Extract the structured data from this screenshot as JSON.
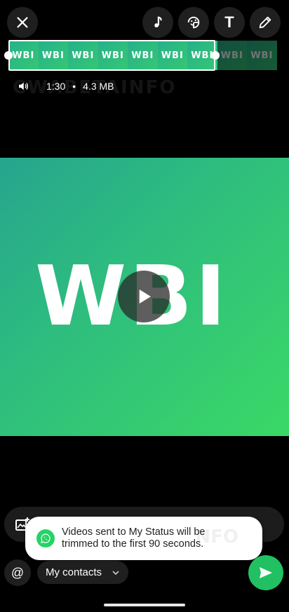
{
  "top_bar": {
    "close_icon": "close-icon",
    "tools": [
      "music-note-icon",
      "sticker-icon",
      "text-icon",
      "pencil-icon"
    ],
    "text_tool_label": "T"
  },
  "trim": {
    "frame_label": "WBI",
    "frames_selected": 7,
    "frames_dim": 2
  },
  "meta": {
    "duration": "1:30",
    "separator": "•",
    "size": "4.3 MB",
    "watermark": "CWABETAINFO"
  },
  "video": {
    "logo_text": "WBI",
    "play_icon": "play-icon"
  },
  "toast": {
    "message": "Videos sent to My Status will be trimmed to the first 90 seconds.",
    "watermark": "NFO"
  },
  "bottom": {
    "mention_label": "@",
    "audience_label": "My contacts",
    "send_icon": "send-icon"
  },
  "colors": {
    "accent": "#21c063",
    "video_start": "#26a58e",
    "video_end": "#3ad866"
  }
}
